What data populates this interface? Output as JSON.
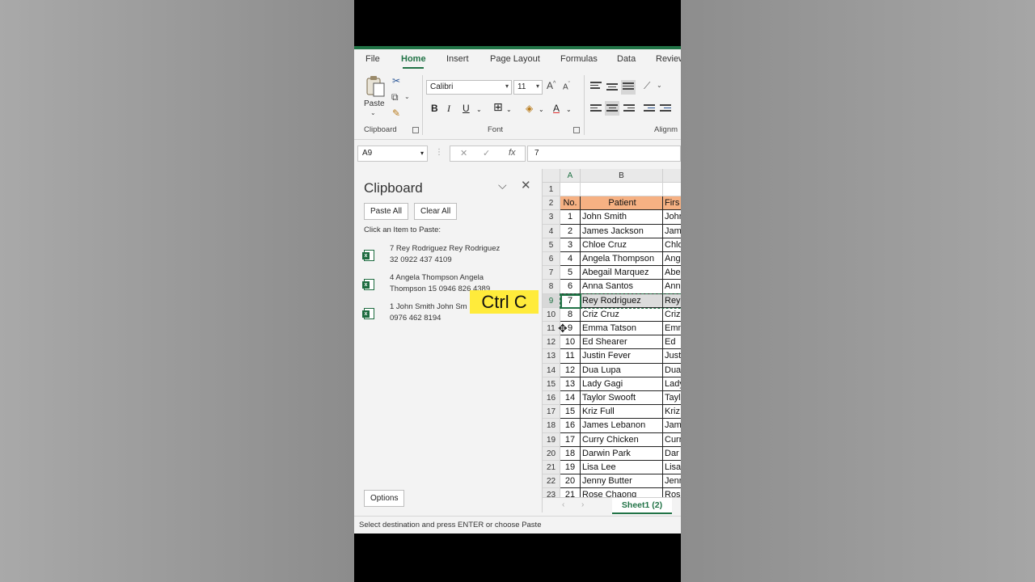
{
  "tabs": [
    "File",
    "Home",
    "Insert",
    "Page Layout",
    "Formulas",
    "Data",
    "Review"
  ],
  "ribbon": {
    "paste_label": "Paste",
    "clipboard_group": "Clipboard",
    "font_group": "Font",
    "alignment_group": "Alignm",
    "font_name": "Calibri",
    "font_size": "11"
  },
  "formula_bar": {
    "name_box": "A9",
    "formula_value": "7"
  },
  "clipboard_pane": {
    "title": "Clipboard",
    "paste_all": "Paste All",
    "clear_all": "Clear All",
    "hint": "Click an Item to Paste:",
    "items": [
      {
        "line1": "7 Rey Rodriguez Rey Rodriguez",
        "line2": "32 0922 437 4109"
      },
      {
        "line1": "4 Angela Thompson Angela",
        "line2": "Thompson 15 0946 826 4389"
      },
      {
        "line1": "1 John Smith John Sm",
        "line2": "0976 462 8194"
      }
    ],
    "options": "Options"
  },
  "grid": {
    "columns": [
      "A",
      "B"
    ],
    "row_numbers": [
      "1",
      "2",
      "3",
      "4",
      "5",
      "6",
      "7",
      "8",
      "9",
      "10",
      "11",
      "12",
      "13",
      "14",
      "15",
      "16",
      "17",
      "18",
      "19",
      "20",
      "21",
      "22",
      "23"
    ],
    "header": {
      "no": "No.",
      "patient": "Patient",
      "first": "Firs"
    },
    "rows": [
      {
        "no": "1",
        "patient": "John Smith",
        "first": "John"
      },
      {
        "no": "2",
        "patient": "James Jackson",
        "first": "Jam"
      },
      {
        "no": "3",
        "patient": "Chloe Cruz",
        "first": "Chlo"
      },
      {
        "no": "4",
        "patient": "Angela Thompson",
        "first": "Ang"
      },
      {
        "no": "5",
        "patient": "Abegail Marquez",
        "first": "Abe"
      },
      {
        "no": "6",
        "patient": "Anna Santos",
        "first": "Ann"
      },
      {
        "no": "7",
        "patient": "Rey Rodriguez",
        "first": "Rey"
      },
      {
        "no": "8",
        "patient": "Criz Cruz",
        "first": "Criz"
      },
      {
        "no": "9",
        "patient": "Emma Tatson",
        "first": "Emm"
      },
      {
        "no": "10",
        "patient": "Ed Shearer",
        "first": "Ed"
      },
      {
        "no": "11",
        "patient": "Justin Fever",
        "first": "Just"
      },
      {
        "no": "12",
        "patient": "Dua Lupa",
        "first": "Dua"
      },
      {
        "no": "13",
        "patient": "Lady Gagi",
        "first": "Lady"
      },
      {
        "no": "14",
        "patient": "Taylor Swooft",
        "first": "Tayl"
      },
      {
        "no": "15",
        "patient": "Kriz Full",
        "first": "Kriz"
      },
      {
        "no": "16",
        "patient": "James Lebanon",
        "first": "Jam"
      },
      {
        "no": "17",
        "patient": "Curry Chicken",
        "first": "Curr"
      },
      {
        "no": "18",
        "patient": "Darwin Park",
        "first": "Dar"
      },
      {
        "no": "19",
        "patient": "Lisa Lee",
        "first": "Lisa"
      },
      {
        "no": "20",
        "patient": "Jenny Butter",
        "first": "Jenn"
      },
      {
        "no": "21",
        "patient": "Rose Chaong",
        "first": "Ros"
      }
    ]
  },
  "sheet_tab": "Sheet1 (2)",
  "status_text": "Select destination and press ENTER or choose Paste",
  "overlay_label": "Ctrl C",
  "colors": {
    "accent": "#217346",
    "header_fill": "#f6b183",
    "overlay": "#ffeb3b"
  }
}
